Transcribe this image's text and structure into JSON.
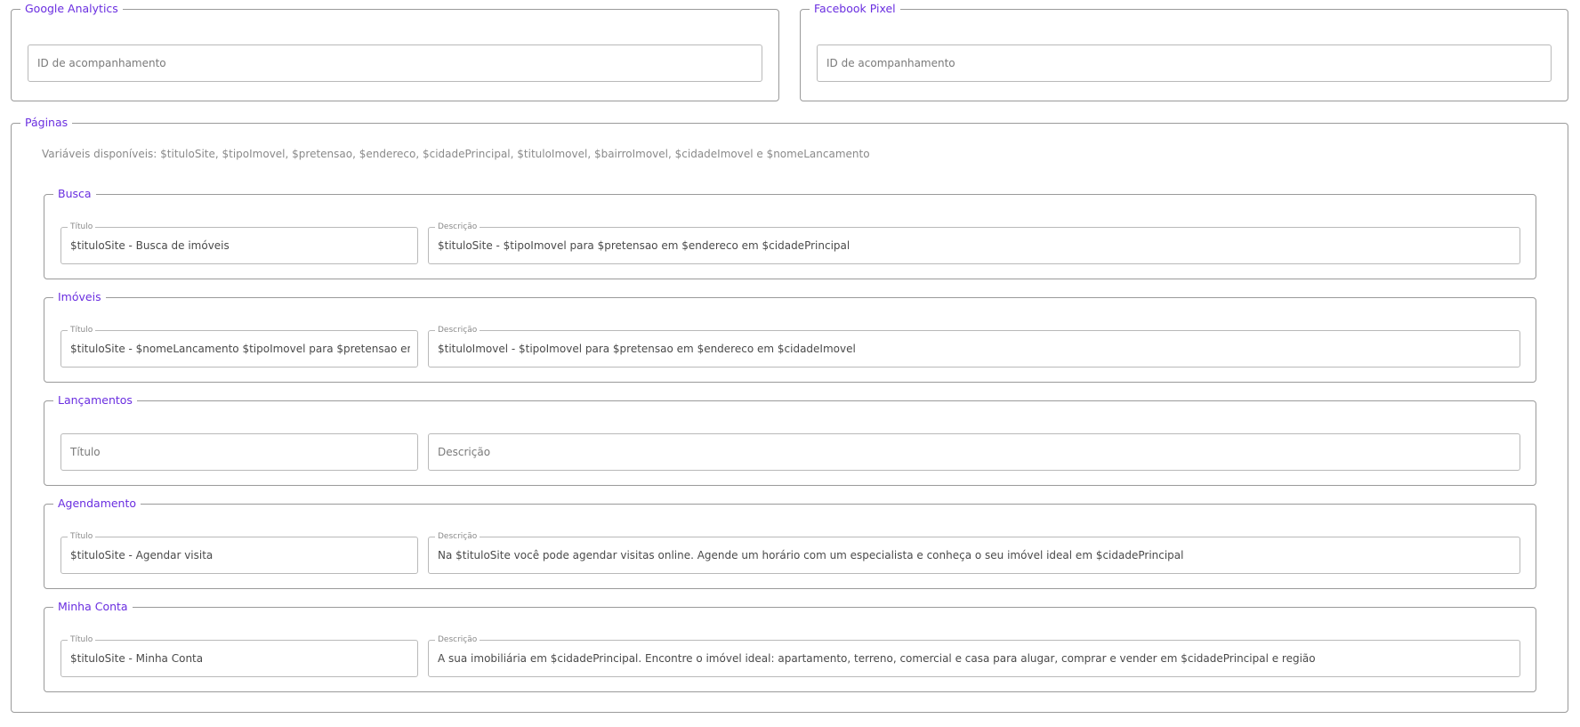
{
  "google_analytics": {
    "legend": "Google Analytics",
    "placeholder": "ID de acompanhamento"
  },
  "facebook_pixel": {
    "legend": "Facebook Pixel",
    "placeholder": "ID de acompanhamento"
  },
  "pages": {
    "legend": "Páginas",
    "variables_text": "Variáveis disponíveis: $tituloSite, $tipoImovel, $pretensao, $endereco, $cidadePrincipal, $tituloImovel, $bairroImovel, $cidadeImovel e $nomeLancamento",
    "sections": [
      {
        "legend": "Busca",
        "title_label": "Título",
        "title_value": "$tituloSite - Busca de imóveis",
        "description_label": "Descrição",
        "description_value": "$tituloSite - $tipoImovel para $pretensao em $endereco em $cidadePrincipal"
      },
      {
        "legend": "Imóveis",
        "title_label": "Título",
        "title_value": "$tituloSite - $nomeLancamento $tipoImovel para $pretensao em $bairroImovel",
        "description_label": "Descrição",
        "description_value": "$tituloImovel - $tipoImovel para $pretensao em $endereco em $cidadeImovel"
      },
      {
        "legend": "Lançamentos",
        "title_placeholder": "Título",
        "description_placeholder": "Descrição"
      },
      {
        "legend": "Agendamento",
        "title_label": "Título",
        "title_value": "$tituloSite - Agendar visita",
        "description_label": "Descrição",
        "description_value": "Na $tituloSite você pode agendar visitas online. Agende um horário com um especialista e conheça o seu imóvel ideal em $cidadePrincipal"
      },
      {
        "legend": "Minha Conta",
        "title_label": "Título",
        "title_value": "$tituloSite - Minha Conta",
        "description_label": "Descrição",
        "description_value": "A sua imobiliária em $cidadePrincipal. Encontre o imóvel ideal: apartamento, terreno, comercial e casa para alugar, comprar e vender em $cidadePrincipal e região"
      }
    ]
  }
}
